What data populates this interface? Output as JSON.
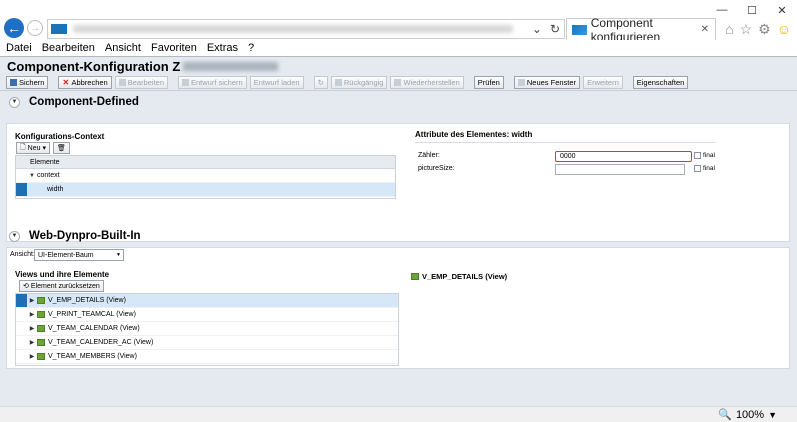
{
  "browser": {
    "tab_title": "Component konfigurieren",
    "menu": [
      "Datei",
      "Bearbeiten",
      "Ansicht",
      "Favoriten",
      "Extras",
      "?"
    ],
    "zoom": "100%"
  },
  "app": {
    "title": "Component-Konfiguration Z",
    "toolbar": [
      {
        "label": "Sichern",
        "enabled": true,
        "icon": "save-icon"
      },
      {
        "label": "Abbrechen",
        "enabled": true,
        "icon": "cancel-icon"
      },
      {
        "label": "Bearbeiten",
        "enabled": false,
        "icon": "edit-icon"
      },
      {
        "label": "Entwurf sichern",
        "enabled": false,
        "icon": "save-draft-icon"
      },
      {
        "label": "Entwurf laden",
        "enabled": false,
        "icon": ""
      },
      {
        "label": "Rückgängig",
        "enabled": false,
        "icon": "undo-icon"
      },
      {
        "label": "Wiederherstellen",
        "enabled": false,
        "icon": "redo-icon"
      },
      {
        "label": "Prüfen",
        "enabled": true,
        "icon": ""
      },
      {
        "label": "Neues Fenster",
        "enabled": true,
        "icon": "new-window-icon"
      },
      {
        "label": "Erweitern",
        "enabled": false,
        "icon": ""
      },
      {
        "label": "Eigenschaften",
        "enabled": true,
        "icon": ""
      }
    ]
  },
  "component_defined": {
    "heading": "Component-Defined",
    "context_title": "Konfigurations-Context",
    "new_button": "Neu",
    "tree_header": "Elemente",
    "tree": [
      {
        "label": "context",
        "level": 0,
        "expanded": true,
        "selected": false
      },
      {
        "label": "width",
        "level": 1,
        "expanded": false,
        "selected": true
      }
    ],
    "attributes_title": "Attribute des Elementes: width",
    "fields": [
      {
        "label": "Zähler:",
        "value": "0000",
        "final_label": "final"
      },
      {
        "label": "pictureSize:",
        "value": "",
        "final_label": "final"
      }
    ]
  },
  "builtin": {
    "heading": "Web-Dynpro-Built-In",
    "view_label": "Ansicht:",
    "view_value": "UI-Element-Baum",
    "views_title": "Views und ihre Elemente",
    "reset_button": "Element zurücksetzen",
    "views": [
      {
        "label": "V_EMP_DETAILS (View)",
        "selected": true
      },
      {
        "label": "V_PRINT_TEAMCAL (View)",
        "selected": false
      },
      {
        "label": "V_TEAM_CALENDAR (View)",
        "selected": false
      },
      {
        "label": "V_TEAM_CALENDER_AC (View)",
        "selected": false
      },
      {
        "label": "V_TEAM_MEMBERS (View)",
        "selected": false
      }
    ],
    "selected_view_title": "V_EMP_DETAILS (View)"
  }
}
